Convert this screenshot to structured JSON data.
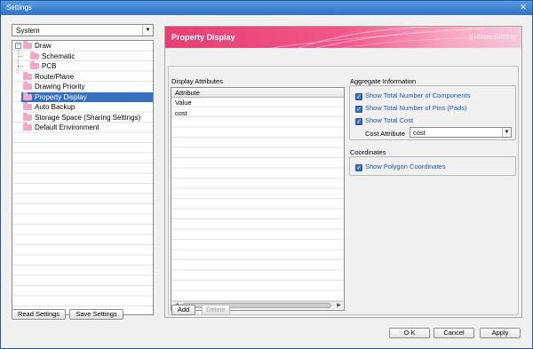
{
  "window": {
    "title": "Settings"
  },
  "category_select": {
    "value": "System"
  },
  "tree": {
    "items": [
      {
        "label": "Draw",
        "level": 0,
        "expanded": true
      },
      {
        "label": "Schematic",
        "level": 1
      },
      {
        "label": "PCB",
        "level": 1
      },
      {
        "label": "Route/Plane",
        "level": 0
      },
      {
        "label": "Drawing Priority",
        "level": 0
      },
      {
        "label": "Property Display",
        "level": 0,
        "selected": true
      },
      {
        "label": "Auto Backup",
        "level": 0
      },
      {
        "label": "Storage Space (Sharing Settings)",
        "level": 0
      },
      {
        "label": "Default Environment",
        "level": 0
      }
    ],
    "expander_symbol": "−"
  },
  "left_buttons": {
    "read": "Read Settings",
    "save": "Save Settings"
  },
  "banner": {
    "title": "Property Display",
    "subtitle": "System Setting"
  },
  "display_attributes": {
    "group_label": "Display Attributes",
    "column_header": "Attribute",
    "rows": [
      "Value",
      "cost"
    ],
    "add_label": "Add",
    "delete_label": "Delete"
  },
  "aggregate": {
    "group_label": "Aggregate Information",
    "checks": [
      {
        "label": "Show Total Number of Components",
        "checked": true
      },
      {
        "label": "Show Total Number of Pins (Pads)",
        "checked": true
      },
      {
        "label": "Show Total Cost",
        "checked": true
      }
    ],
    "cost_attribute_label": "Cost Attribute",
    "cost_attribute_value": "cost"
  },
  "coordinates": {
    "group_label": "Coordinates",
    "checks": [
      {
        "label": "Show Polygon Coordinates",
        "checked": true
      }
    ]
  },
  "footer_buttons": {
    "ok": "O K",
    "cancel": "Cancel",
    "apply": "Apply"
  },
  "colors": {
    "selection": "#3870c0",
    "banner_start": "#e73e73",
    "check": "#3a6fc0"
  }
}
